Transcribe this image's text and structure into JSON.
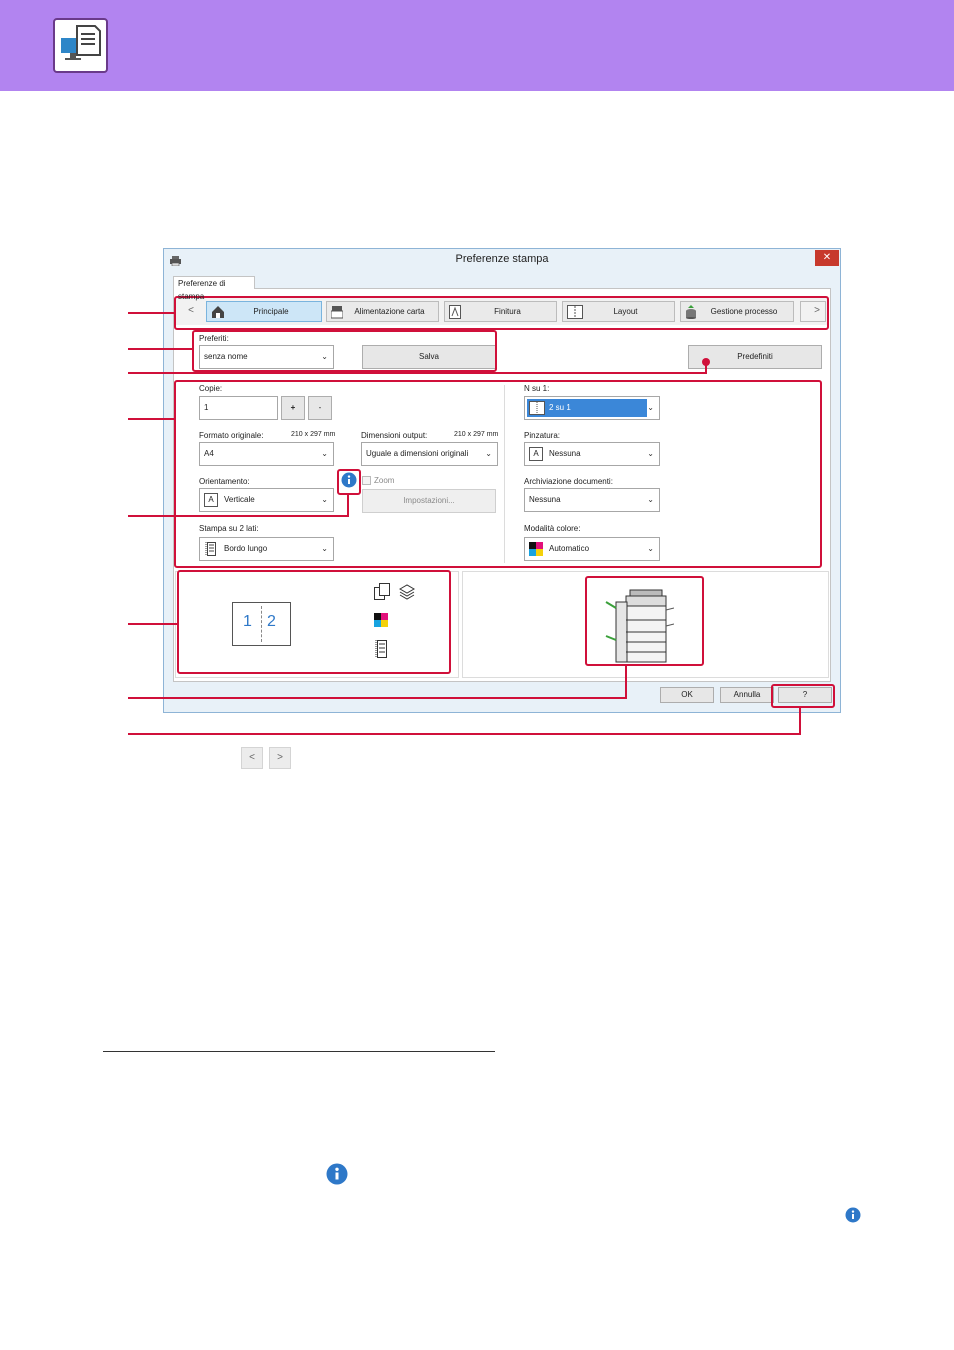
{
  "dialog": {
    "title": "Preferenze stampa",
    "close": "✕",
    "tab": "Preferenze di stampa",
    "nav_prev": "<",
    "nav_next": ">",
    "nav_tabs": [
      "Principale",
      "Alimentazione carta",
      "Finitura",
      "Layout",
      "Gestione processo"
    ],
    "favorites": {
      "label": "Preferiti:",
      "value": "senza nome",
      "save": "Salva",
      "defaults": "Predefiniti"
    },
    "copies": {
      "label": "Copie:",
      "value": "1",
      "plus": "+",
      "minus": "-"
    },
    "original_size": {
      "label": "Formato originale:",
      "dims": "210 x 297 mm",
      "value": "A4"
    },
    "output_size": {
      "label": "Dimensioni output:",
      "dims": "210 x 297 mm",
      "value": "Uguale a dimensioni originali"
    },
    "orientation": {
      "label": "Orientamento:",
      "value": "Verticale"
    },
    "zoom": {
      "label": "Zoom",
      "settings": "Impostazioni..."
    },
    "duplex": {
      "label": "Stampa su 2 lati:",
      "value": "Bordo lungo"
    },
    "n_up": {
      "label": "N su 1:",
      "value": "2 su 1"
    },
    "staple": {
      "label": "Pinzatura:",
      "value": "Nessuna"
    },
    "retention": {
      "label": "Archiviazione documenti:",
      "value": "Nessuna"
    },
    "color_mode": {
      "label": "Modalità colore:",
      "value": "Automatico"
    },
    "preview": {
      "page1": "1",
      "page2": "2"
    },
    "footer": {
      "ok": "OK",
      "cancel": "Annulla",
      "help": "?"
    }
  },
  "pager": {
    "prev": "<",
    "next": ">"
  },
  "colors": {
    "banner": "#b284f0",
    "callout": "#d0103a",
    "info": "#2e78c8"
  }
}
